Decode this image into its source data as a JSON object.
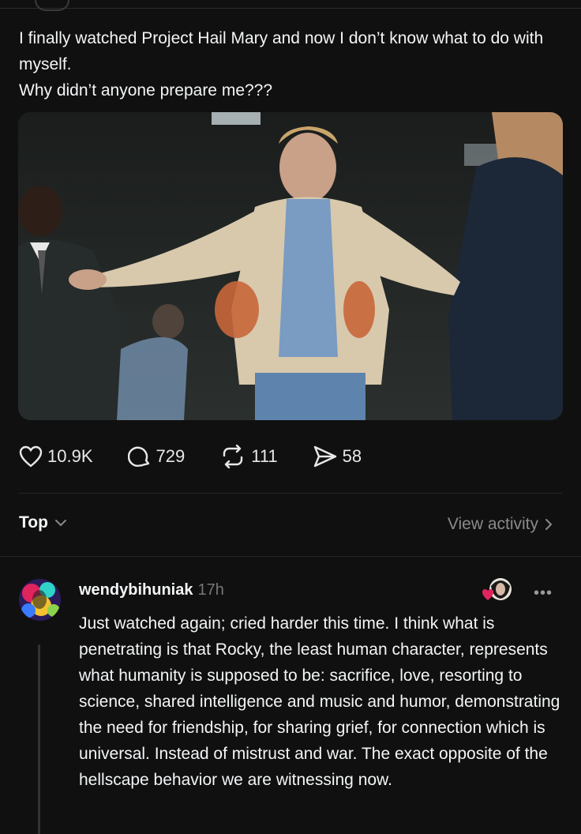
{
  "post": {
    "line1": "I finally watched Project Hail Mary and now I don’t know what to do with myself.",
    "line2": "Why didn’t anyone prepare me???"
  },
  "media": {
    "description_icon": "photo-image"
  },
  "actions": {
    "likes": "10.9K",
    "replies": "729",
    "reposts": "111",
    "shares": "58"
  },
  "sort": {
    "label": "Top",
    "activity_label": "View activity"
  },
  "reply": {
    "username": "wendybihuniak",
    "time": "17h",
    "text": "Just watched again; cried harder this time. I think what is penetrating is that Rocky, the least human character, represents what humanity is supposed to be: sacrifice, love, resorting to science, shared intelligence and music and humor, demonstrating the need for friendship, for sharing grief, for connection which is universal. Instead of mistrust and war. The exact opposite of the hellscape behavior we are witnessing now.",
    "more": "•••"
  },
  "colors": {
    "background": "#101010",
    "text": "#f3f5f7",
    "muted": "#8a8a8a",
    "like_heart": "#e0245e"
  }
}
